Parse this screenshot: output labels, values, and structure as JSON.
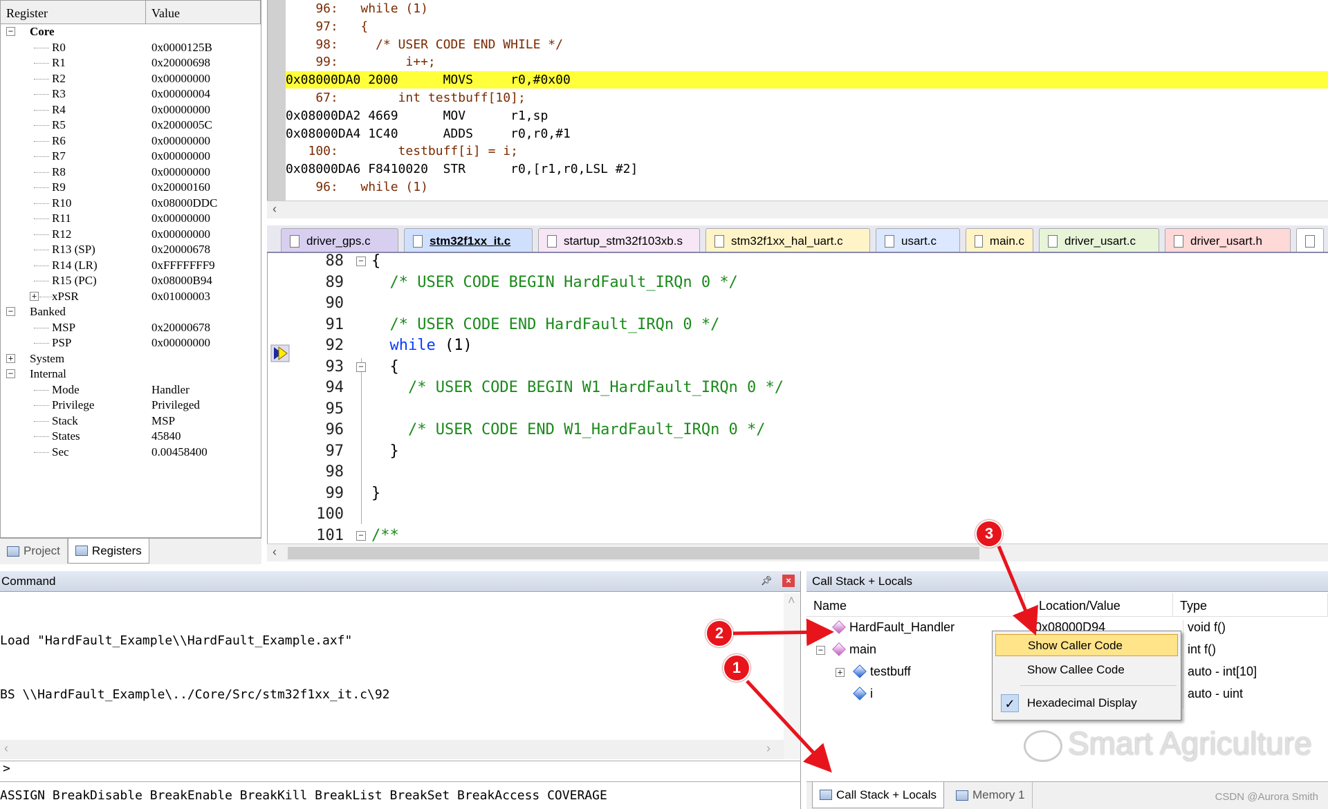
{
  "registers": {
    "headers": [
      "Register",
      "Value"
    ],
    "core_label": "Core",
    "core": [
      {
        "name": "R0",
        "value": "0x0000125B"
      },
      {
        "name": "R1",
        "value": "0x20000698"
      },
      {
        "name": "R2",
        "value": "0x00000000"
      },
      {
        "name": "R3",
        "value": "0x00000004"
      },
      {
        "name": "R4",
        "value": "0x00000000"
      },
      {
        "name": "R5",
        "value": "0x2000005C"
      },
      {
        "name": "R6",
        "value": "0x00000000"
      },
      {
        "name": "R7",
        "value": "0x00000000"
      },
      {
        "name": "R8",
        "value": "0x00000000"
      },
      {
        "name": "R9",
        "value": "0x20000160"
      },
      {
        "name": "R10",
        "value": "0x08000DDC"
      },
      {
        "name": "R11",
        "value": "0x00000000"
      },
      {
        "name": "R12",
        "value": "0x00000000"
      },
      {
        "name": "R13 (SP)",
        "value": "0x20000678"
      },
      {
        "name": "R14 (LR)",
        "value": "0xFFFFFFF9"
      },
      {
        "name": "R15 (PC)",
        "value": "0x08000B94"
      },
      {
        "name": "xPSR",
        "value": "0x01000003"
      }
    ],
    "banked_label": "Banked",
    "banked": [
      {
        "name": "MSP",
        "value": "0x20000678"
      },
      {
        "name": "PSP",
        "value": "0x00000000"
      }
    ],
    "system_label": "System",
    "internal_label": "Internal",
    "internal": [
      {
        "name": "Mode",
        "value": "Handler"
      },
      {
        "name": "Privilege",
        "value": "Privileged"
      },
      {
        "name": "Stack",
        "value": "MSP"
      },
      {
        "name": "States",
        "value": "45840"
      },
      {
        "name": "Sec",
        "value": "0.00458400"
      }
    ],
    "tabs": [
      "Project",
      "Registers"
    ]
  },
  "disassembly": [
    {
      "text": "    96:   while (1)",
      "kind": "src"
    },
    {
      "text": "    97:   {",
      "kind": "src"
    },
    {
      "text": "    98:     /* USER CODE END WHILE */",
      "kind": "src"
    },
    {
      "text": "    99:         i++;",
      "kind": "src"
    },
    {
      "text": "0x08000DA0 2000      MOVS     r0,#0x00",
      "kind": "hl"
    },
    {
      "text": "    67:        int testbuff[10];",
      "kind": "src"
    },
    {
      "text": "0x08000DA2 4669      MOV      r1,sp",
      "kind": "asm"
    },
    {
      "text": "0x08000DA4 1C40      ADDS     r0,r0,#1",
      "kind": "asm"
    },
    {
      "text": "   100:        testbuff[i] = i;",
      "kind": "src"
    },
    {
      "text": "0x08000DA6 F8410020  STR      r0,[r1,r0,LSL #2]",
      "kind": "asm"
    },
    {
      "text": "    96:   while (1)",
      "kind": "src"
    }
  ],
  "editor_tabs": [
    "driver_gps.c",
    "stm32f1xx_it.c",
    "startup_stm32f103xb.s",
    "stm32f1xx_hal_uart.c",
    "usart.c",
    "main.c",
    "driver_usart.c",
    "driver_usart.h"
  ],
  "editor_lines": [
    {
      "n": "88",
      "code": "{",
      "cls": ""
    },
    {
      "n": "89",
      "code": "  /* USER CODE BEGIN HardFault_IRQn 0 */",
      "cls": "cm"
    },
    {
      "n": "90",
      "code": "",
      "cls": ""
    },
    {
      "n": "91",
      "code": "  /* USER CODE END HardFault_IRQn 0 */",
      "cls": "cm"
    },
    {
      "n": "92",
      "code": "  while (1)",
      "cls": "while"
    },
    {
      "n": "93",
      "code": "  {",
      "cls": ""
    },
    {
      "n": "94",
      "code": "    /* USER CODE BEGIN W1_HardFault_IRQn 0 */",
      "cls": "cm"
    },
    {
      "n": "95",
      "code": "",
      "cls": ""
    },
    {
      "n": "96",
      "code": "    /* USER CODE END W1_HardFault_IRQn 0 */",
      "cls": "cm"
    },
    {
      "n": "97",
      "code": "  }",
      "cls": ""
    },
    {
      "n": "98",
      "code": "",
      "cls": ""
    },
    {
      "n": "99",
      "code": "}",
      "cls": ""
    },
    {
      "n": "100",
      "code": "",
      "cls": ""
    },
    {
      "n": "101",
      "code": "/**",
      "cls": "cm"
    }
  ],
  "command": {
    "title": "Command",
    "lines": [
      "Load \"HardFault_Example\\\\HardFault_Example.axf\"",
      "BS \\\\HardFault_Example\\../Core/Src/stm32f1xx_it.c\\92"
    ],
    "prompt": ">",
    "help": "ASSIGN BreakDisable BreakEnable BreakKill BreakList BreakSet BreakAccess COVERAGE"
  },
  "callstack": {
    "title": "Call Stack + Locals",
    "headers": [
      "Name",
      "Location/Value",
      "Type"
    ],
    "rows": [
      {
        "name": "HardFault_Handler",
        "loc": "0x08000D94",
        "type": "void f()"
      },
      {
        "name": "main",
        "loc": "",
        "type": "int f()"
      },
      {
        "name": "testbuff",
        "loc": "",
        "type": "auto - int[10]"
      },
      {
        "name": "i",
        "loc": "",
        "type": "auto - uint"
      }
    ],
    "tabs": [
      "Call Stack + Locals",
      "Memory 1"
    ],
    "menu": [
      "Show Caller Code",
      "Show Callee Code",
      "Hexadecimal Display"
    ]
  },
  "annotations": [
    "1",
    "2",
    "3"
  ],
  "watermark": "Smart Agriculture",
  "credit": "CSDN @Aurora Smith",
  "colors": {
    "highlight": "#ffff3a",
    "comment": "#1a8a1a",
    "keyword": "#0a3aff",
    "arrow": "#e8141c"
  }
}
